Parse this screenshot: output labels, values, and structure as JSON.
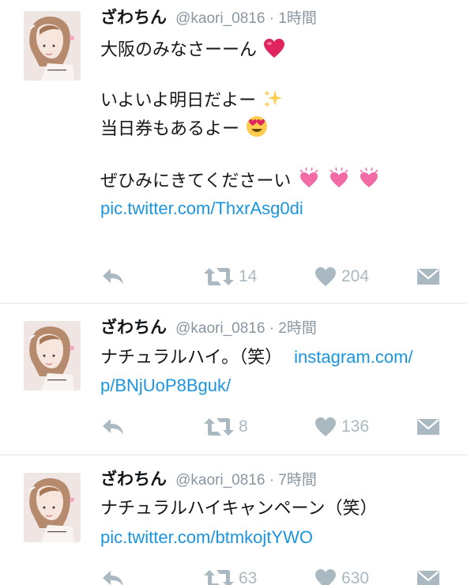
{
  "tweets": [
    {
      "name": "ざわちん",
      "handle": "@kaori_0816",
      "separator": "·",
      "time": "1時間",
      "lines": [
        "大阪のみなさーーん",
        "",
        "いよいよ明日だよー",
        "当日券もあるよー",
        "",
        "ぜひみにきてくださーい"
      ],
      "line_emojis": [
        "heart-emoji",
        "",
        "sparkles-emoji",
        "heart-eyes-emoji",
        "",
        "heart-emoji x3"
      ],
      "link": "pic.twitter.com/ThxrAsg0di",
      "retweets": "14",
      "likes": "204"
    },
    {
      "name": "ざわちん",
      "handle": "@kaori_0816",
      "separator": "·",
      "time": "2時間",
      "text": "ナチュラルハイ。（笑）",
      "link_part1": "instagram.com/",
      "link_part2": "p/BNjUoP8Bguk/",
      "retweets": "8",
      "likes": "136"
    },
    {
      "name": "ざわちん",
      "handle": "@kaori_0816",
      "separator": "·",
      "time": "7時間",
      "text": "ナチュラルハイキャンペーン（笑）",
      "link": "pic.twitter.com/btmkojtYWO",
      "retweets": "63",
      "likes": "630"
    }
  ],
  "colors": {
    "link": "#1b95e0",
    "icon": "#aab8c2",
    "meta": "#8a96a0",
    "text": "#14171a",
    "divider": "#e1e8ed",
    "heart_emoji": "#e0245e",
    "pink_heart_emoji": "#f26ba5",
    "sparkles_emoji": "#ffcc4d"
  }
}
